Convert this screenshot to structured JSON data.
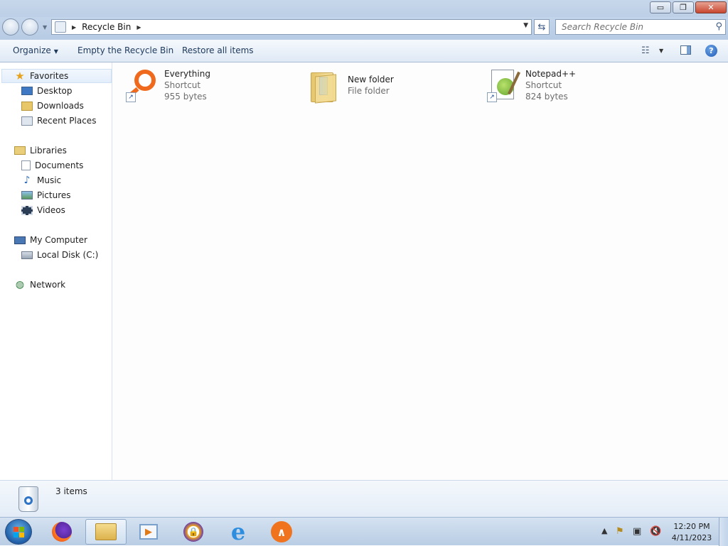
{
  "window": {
    "buttons": {
      "minimize": "▭",
      "maximize": "❐",
      "close": "✕"
    }
  },
  "address": {
    "location": "Recycle Bin",
    "search_placeholder": "Search Recycle Bin"
  },
  "toolbar": {
    "organize": "Organize",
    "empty": "Empty the Recycle Bin",
    "restore": "Restore all items"
  },
  "nav": {
    "favorites": {
      "label": "Favorites",
      "items": [
        {
          "label": "Desktop",
          "icon": "desktop-icon"
        },
        {
          "label": "Downloads",
          "icon": "downloads-icon"
        },
        {
          "label": "Recent Places",
          "icon": "recent-places-icon"
        }
      ]
    },
    "libraries": {
      "label": "Libraries",
      "items": [
        {
          "label": "Documents",
          "icon": "documents-icon"
        },
        {
          "label": "Music",
          "icon": "music-icon"
        },
        {
          "label": "Pictures",
          "icon": "pictures-icon"
        },
        {
          "label": "Videos",
          "icon": "videos-icon"
        }
      ]
    },
    "computer": {
      "label": "My Computer",
      "items": [
        {
          "label": "Local Disk (C:)",
          "icon": "local-disk-icon"
        }
      ]
    },
    "network": {
      "label": "Network"
    }
  },
  "files": [
    {
      "name": "Everything",
      "type": "Shortcut",
      "size": "955 bytes",
      "icon": "everything-icon"
    },
    {
      "name": "New folder",
      "type": "File folder",
      "icon": "folder-icon"
    },
    {
      "name": "Notepad++",
      "type": "Shortcut",
      "size": "824 bytes",
      "icon": "notepad-plus-plus-icon"
    }
  ],
  "details": {
    "count": "3 items"
  },
  "taskbar": {
    "apps": [
      "firefox-icon",
      "explorer-icon",
      "media-player-icon",
      "keepass-icon",
      "internet-explorer-icon",
      "vlc-icon"
    ],
    "clock_time": "12:20 PM",
    "clock_date": "4/11/2023"
  },
  "colors": {
    "titlebar": "#c7d7eb",
    "link_text": "#1e395b",
    "meta_text": "#6d6d6d",
    "selection": "#e3eefb"
  }
}
